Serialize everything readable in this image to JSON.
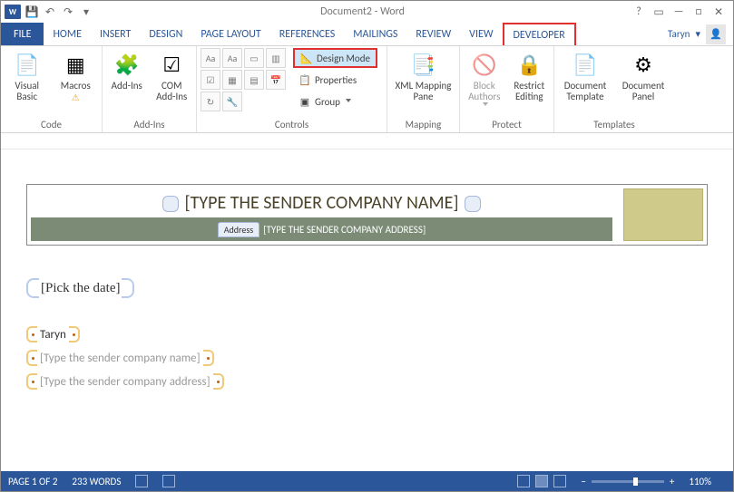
{
  "titlebar": {
    "doc_title": "Document2 - Word"
  },
  "tabs": {
    "file": "FILE",
    "home": "HOME",
    "insert": "INSERT",
    "design": "DESIGN",
    "page_layout": "PAGE LAYOUT",
    "references": "REFERENCES",
    "mailings": "MAILINGS",
    "review": "REVIEW",
    "view": "VIEW",
    "developer": "DEVELOPER",
    "user_name": "Taryn"
  },
  "ribbon": {
    "code": {
      "label": "Code",
      "visual_basic": "Visual\nBasic",
      "macros": "Macros"
    },
    "addins_group": {
      "label": "Add-Ins",
      "addins": "Add-Ins",
      "com_addins": "COM\nAdd-Ins"
    },
    "controls": {
      "label": "Controls",
      "design_mode": "Design Mode",
      "properties": "Properties",
      "group": "Group"
    },
    "mapping": {
      "label": "Mapping",
      "xml_mapping": "XML Mapping\nPane"
    },
    "protect": {
      "label": "Protect",
      "block_authors": "Block\nAuthors",
      "restrict_editing": "Restrict\nEditing"
    },
    "templates": {
      "label": "Templates",
      "doc_template": "Document\nTemplate",
      "doc_panel": "Document\nPanel"
    }
  },
  "document": {
    "header_title": "[TYPE THE SENDER COMPANY NAME]",
    "addr_label": "Address",
    "addr_ph": "[TYPE THE SENDER COMPANY ADDRESS]",
    "date_ph": "[Pick the date]",
    "body_name": "Taryn",
    "body_ph1": "[Type the sender company name]",
    "body_ph2": "[Type the sender company address]"
  },
  "status": {
    "page": "PAGE 1 OF 2",
    "words": "233 WORDS",
    "zoom": "110%"
  }
}
